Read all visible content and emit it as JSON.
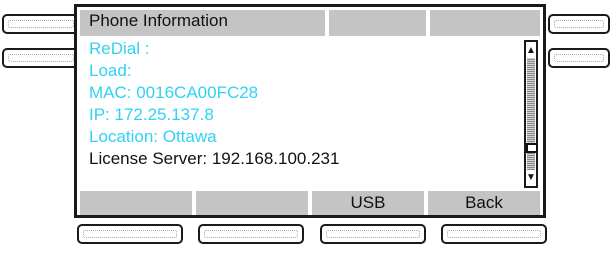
{
  "screen": {
    "title": "Phone Information",
    "rows": [
      {
        "label": "ReDial  :"
      },
      {
        "label": "Load:"
      },
      {
        "label": "MAC:  0016CA00FC28"
      },
      {
        "label": "IP:  172.25.137.8"
      },
      {
        "label": "Location:  Ottawa"
      },
      {
        "label": "License Server: 192.168.100.231"
      }
    ],
    "selected_index": 5,
    "scroll_position": 0.83
  },
  "softkeys": [
    "",
    "",
    "USB",
    "Back"
  ],
  "icons": {
    "scroll_up": "arrow-up-icon",
    "scroll_down": "arrow-down-icon"
  },
  "colors": {
    "item_text": "#2fd2f5",
    "selected_text": "#111111",
    "bar_gray": "#c4c4c4"
  }
}
